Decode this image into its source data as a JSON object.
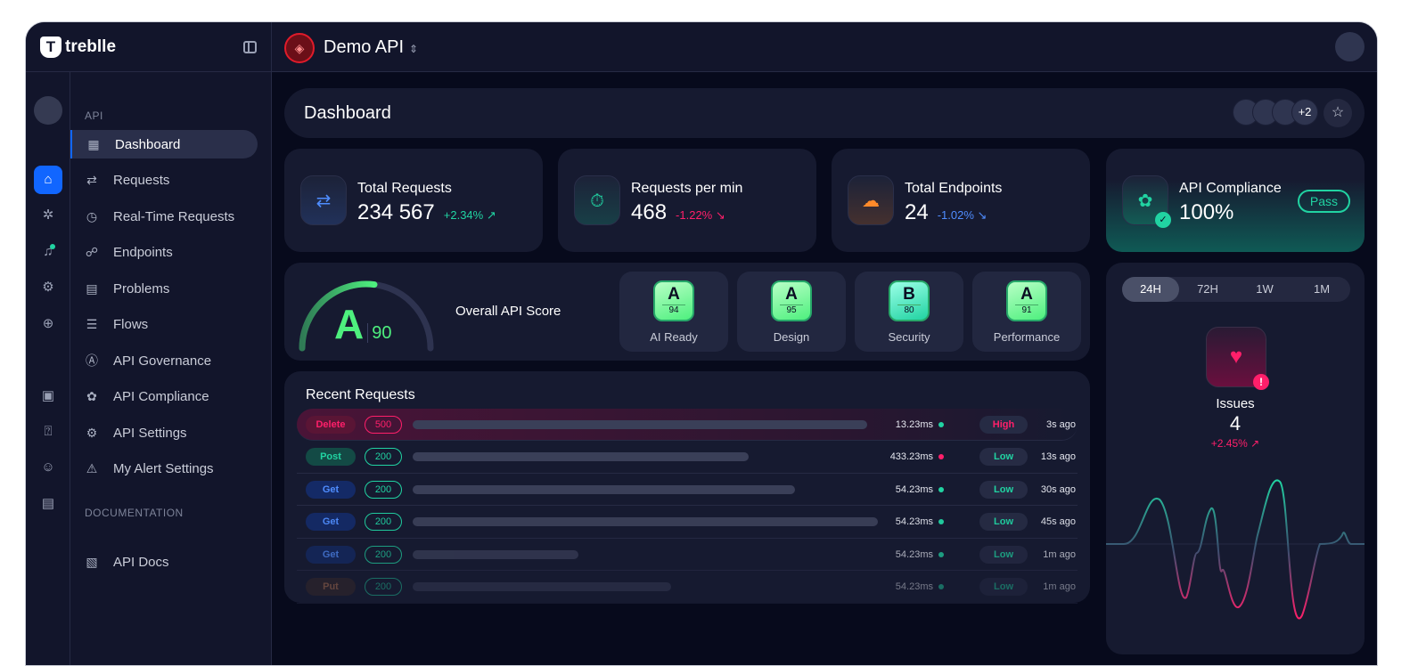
{
  "brand": {
    "name": "treblle"
  },
  "header": {
    "api_name": "Demo API"
  },
  "rail": {
    "icons": [
      "avatar",
      "home-icon",
      "bug-icon",
      "bell-icon",
      "gear-icon",
      "plus-circle-icon",
      "book-icon",
      "help-icon",
      "chat-icon",
      "docs-icon"
    ]
  },
  "nav": {
    "section_api": "API",
    "section_docs": "DOCUMENTATION",
    "items": [
      {
        "label": "Dashboard",
        "icon": "grid-icon",
        "active": true
      },
      {
        "label": "Requests",
        "icon": "arrows-icon"
      },
      {
        "label": "Real-Time Requests",
        "icon": "timer-icon"
      },
      {
        "label": "Endpoints",
        "icon": "endpoints-icon"
      },
      {
        "label": "Problems",
        "icon": "problems-icon"
      },
      {
        "label": "Flows",
        "icon": "flows-icon"
      },
      {
        "label": "API Governance",
        "icon": "governance-icon"
      },
      {
        "label": "API Compliance",
        "icon": "compliance-icon"
      },
      {
        "label": "API Settings",
        "icon": "gear-icon"
      },
      {
        "label": "My Alert Settings",
        "icon": "warning-icon"
      }
    ],
    "docs_items": [
      {
        "label": "API Docs",
        "icon": "docs-icon"
      }
    ]
  },
  "dashboard": {
    "title": "Dashboard",
    "extra_members": "+2"
  },
  "stats": [
    {
      "label": "Total Requests",
      "value": "234 567",
      "change": "+2.34% ↗",
      "color": "#21d3a2",
      "icon_color": "#4f8dff"
    },
    {
      "label": "Requests per min",
      "value": "468",
      "change": "-1.22% ↘",
      "color": "#ff1f6a",
      "icon_color": "#21d3a2"
    },
    {
      "label": "Total Endpoints",
      "value": "24",
      "change": "-1.02% ↘",
      "color": "#4f8dff",
      "icon_color": "#ff8a2a"
    }
  ],
  "compliance": {
    "label": "API Compliance",
    "value": "100%",
    "status": "Pass"
  },
  "score": {
    "grade": "A",
    "value": "90",
    "label": "Overall API Score",
    "percent": 90,
    "subs": [
      {
        "grade": "A",
        "value": "94",
        "name": "AI Ready"
      },
      {
        "grade": "A",
        "value": "95",
        "name": "Design"
      },
      {
        "grade": "B",
        "value": "80",
        "name": "Security"
      },
      {
        "grade": "A",
        "value": "91",
        "name": "Performance"
      }
    ]
  },
  "recent": {
    "title": "Recent Requests",
    "rows": [
      {
        "method": "Delete",
        "code": "500",
        "ms": "13.23ms",
        "dot": "#21d3a2",
        "severity": "High",
        "ago": "3s ago",
        "bar": 0.88
      },
      {
        "method": "Post",
        "code": "200",
        "ms": "433.23ms",
        "dot": "#ff1f6a",
        "severity": "Low",
        "ago": "13s ago",
        "bar": 0.65
      },
      {
        "method": "Get",
        "code": "200",
        "ms": "54.23ms",
        "dot": "#21d3a2",
        "severity": "Low",
        "ago": "30s ago",
        "bar": 0.74
      },
      {
        "method": "Get",
        "code": "200",
        "ms": "54.23ms",
        "dot": "#21d3a2",
        "severity": "Low",
        "ago": "45s ago",
        "bar": 0.9
      },
      {
        "method": "Get",
        "code": "200",
        "ms": "54.23ms",
        "dot": "#21d3a2",
        "severity": "Low",
        "ago": "1m ago",
        "bar": 0.32
      },
      {
        "method": "Put",
        "code": "200",
        "ms": "54.23ms",
        "dot": "#21d3a2",
        "severity": "Low",
        "ago": "1m ago",
        "bar": 0.5
      }
    ]
  },
  "issues": {
    "tabs": [
      "24H",
      "72H",
      "1W",
      "1M"
    ],
    "active_tab": "24H",
    "label": "Issues",
    "value": "4",
    "change": "+2.45% ↗"
  }
}
